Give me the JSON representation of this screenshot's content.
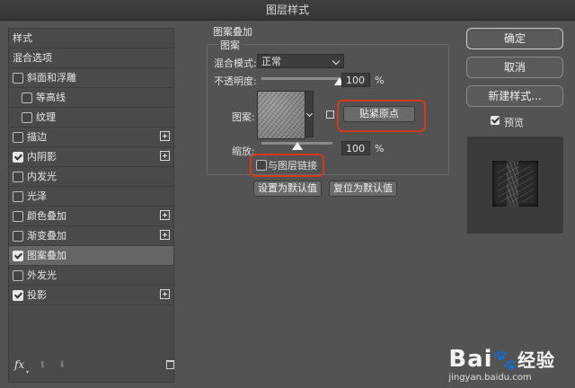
{
  "window": {
    "title": "图层样式"
  },
  "sidebar": {
    "header": "样式",
    "items": [
      {
        "label": "混合选项",
        "checkbox": false,
        "checked": false,
        "indent": false,
        "plus": false,
        "selected": false
      },
      {
        "label": "斜面和浮雕",
        "checkbox": true,
        "checked": false,
        "indent": false,
        "plus": false,
        "selected": false
      },
      {
        "label": "等高线",
        "checkbox": true,
        "checked": false,
        "indent": true,
        "plus": false,
        "selected": false
      },
      {
        "label": "纹理",
        "checkbox": true,
        "checked": false,
        "indent": true,
        "plus": false,
        "selected": false
      },
      {
        "label": "描边",
        "checkbox": true,
        "checked": false,
        "indent": false,
        "plus": true,
        "selected": false
      },
      {
        "label": "内阴影",
        "checkbox": true,
        "checked": true,
        "indent": false,
        "plus": true,
        "selected": false
      },
      {
        "label": "内发光",
        "checkbox": true,
        "checked": false,
        "indent": false,
        "plus": false,
        "selected": false
      },
      {
        "label": "光泽",
        "checkbox": true,
        "checked": false,
        "indent": false,
        "plus": false,
        "selected": false
      },
      {
        "label": "颜色叠加",
        "checkbox": true,
        "checked": false,
        "indent": false,
        "plus": true,
        "selected": false
      },
      {
        "label": "渐变叠加",
        "checkbox": true,
        "checked": false,
        "indent": false,
        "plus": true,
        "selected": false
      },
      {
        "label": "图案叠加",
        "checkbox": true,
        "checked": true,
        "indent": false,
        "plus": false,
        "selected": true
      },
      {
        "label": "外发光",
        "checkbox": true,
        "checked": false,
        "indent": false,
        "plus": false,
        "selected": false
      },
      {
        "label": "投影",
        "checkbox": true,
        "checked": true,
        "indent": false,
        "plus": true,
        "selected": false
      }
    ],
    "footer": {
      "fx": "fx"
    }
  },
  "pattern_overlay": {
    "section_title": "图案叠加",
    "group_title": "图案",
    "blend_mode_label": "混合模式:",
    "blend_mode_value": "正常",
    "opacity_label": "不透明度:",
    "opacity_value": "100",
    "opacity_percent": 1.0,
    "opacity_unit": "%",
    "pattern_label": "图案:",
    "snap_origin_button": "贴紧原点",
    "scale_label": "缩放:",
    "scale_value": "100",
    "scale_unit": "%",
    "link_layer_label": "与图层链接",
    "link_layer_checked": false,
    "set_default_button": "设置为默认值",
    "reset_default_button": "复位为默认值"
  },
  "actions": {
    "ok": "确定",
    "cancel": "取消",
    "new_style": "新建样式...",
    "preview_label": "预览",
    "preview_checked": true
  },
  "watermark": {
    "brand": "Bai",
    "brand_suffix": "经验",
    "url": "jingyan.baidu.com"
  },
  "colors": {
    "background": "#535353",
    "highlight": "#d33a1a"
  }
}
